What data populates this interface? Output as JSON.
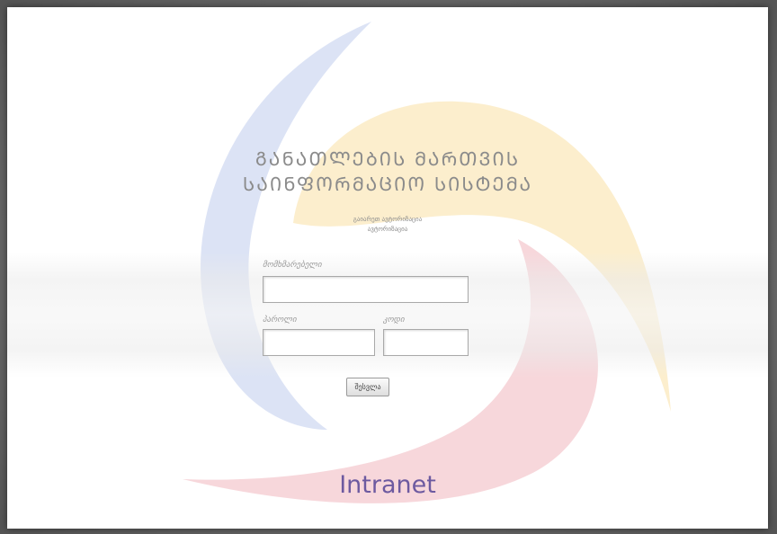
{
  "header": {
    "title_line1": "ᲒᲐᲜᲐᲗᲚᲔᲑᲘᲡ ᲛᲐᲠᲗᲕᲘᲡ",
    "title_line2": "ᲡᲐᲘᲜᲤᲝᲠᲛᲐᲪᲘᲝ ᲡᲘᲡᲢᲔᲛᲐ",
    "subtitle_line1": "გაიარეთ ავტორიზაცია",
    "subtitle_line2": "ავტორიზაცია"
  },
  "login_form": {
    "username_label": "მომხმარებელი",
    "username_value": "",
    "password_label": "პაროლი",
    "password_value": "",
    "code_label": "კოდი",
    "code_value": "",
    "submit_label": "შესვლა"
  },
  "brand": {
    "name": "Intranet"
  },
  "colors": {
    "blue_swirl": "#c9d4ef",
    "yellow_swirl": "#fbe7b8",
    "red_swirl": "#f3c6cc",
    "brand_text": "#6d5aa0",
    "title_text": "#8b8b8b"
  }
}
